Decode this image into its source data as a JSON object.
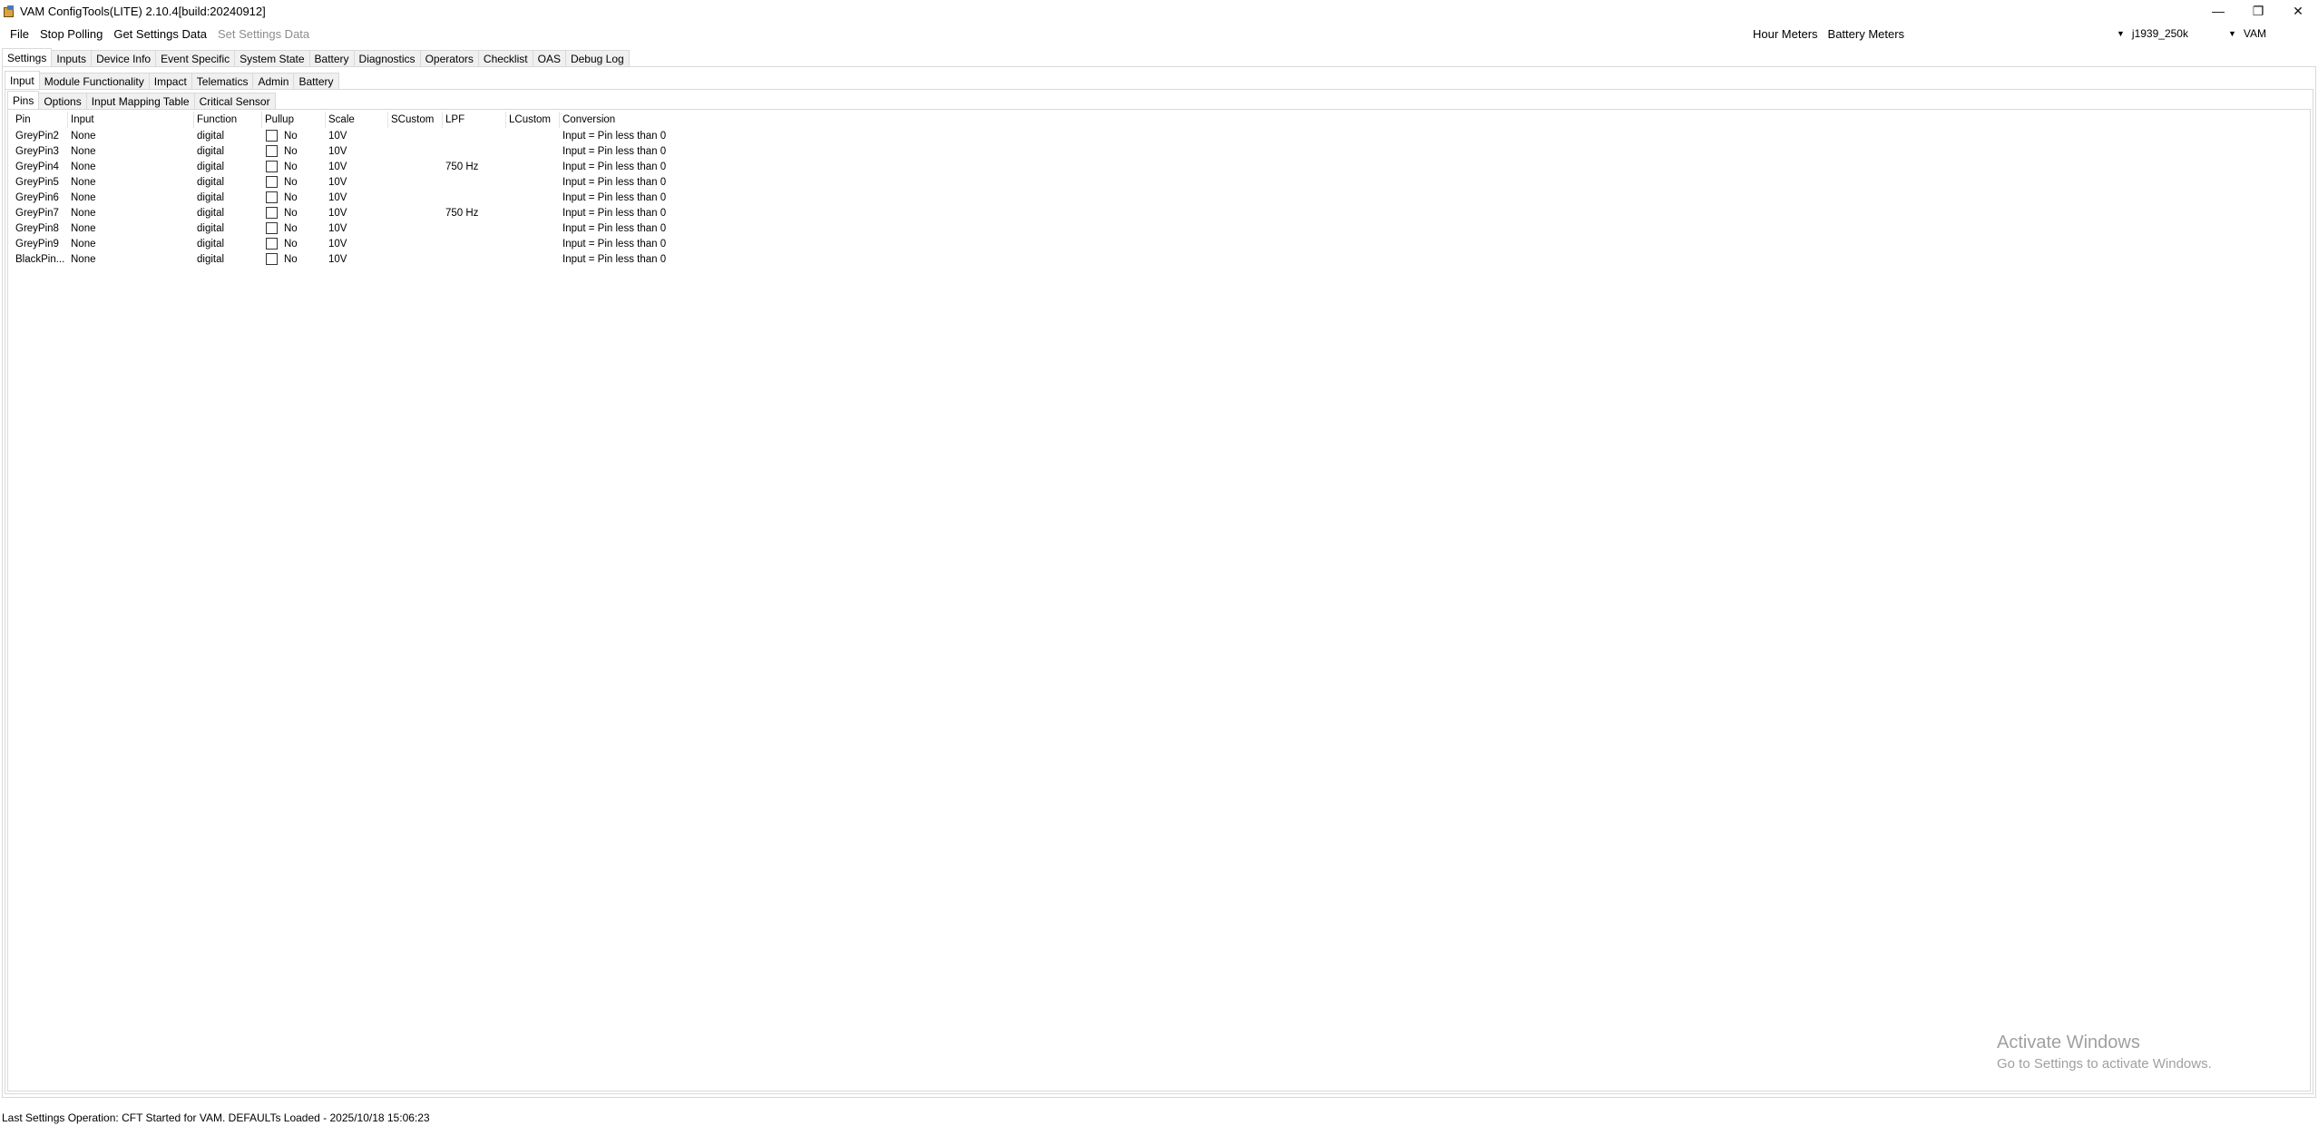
{
  "window": {
    "title": "VAM ConfigTools(LITE) 2.10.4[build:20240912]",
    "controls": {
      "minimize": "—",
      "restore": "❐",
      "close": "✕"
    }
  },
  "menu": {
    "items": [
      {
        "label": "File",
        "enabled": true
      },
      {
        "label": "Stop Polling",
        "enabled": true
      },
      {
        "label": "Get Settings Data",
        "enabled": true
      },
      {
        "label": "Set Settings Data",
        "enabled": false
      }
    ],
    "right_items": [
      "Hour Meters",
      "Battery Meters"
    ],
    "combo_baud": "j1939_250k",
    "combo_device": "VAM"
  },
  "main_tabs": [
    "Settings",
    "Inputs",
    "Device Info",
    "Event Specific",
    "System State",
    "Battery",
    "Diagnostics",
    "Operators",
    "Checklist",
    "OAS",
    "Debug Log"
  ],
  "settings_tabs": [
    "Input",
    "Module Functionality",
    "Impact",
    "Telematics",
    "Admin",
    "Battery"
  ],
  "input_tabs": [
    "Pins",
    "Options",
    "Input Mapping Table",
    "Critical Sensor"
  ],
  "table": {
    "headers": {
      "pin": "Pin",
      "input": "Input",
      "function": "Function",
      "pullup": "Pullup",
      "scale": "Scale",
      "scustom": "SCustom",
      "lpf": "LPF",
      "lcustom": "LCustom",
      "conversion": "Conversion"
    },
    "rows": [
      {
        "pin": "GreyPin2",
        "input": "None",
        "function": "digital",
        "pullup": "No",
        "scale": "10V",
        "scustom": "",
        "lpf": "",
        "lcustom": "",
        "conversion": "Input = Pin less than 0"
      },
      {
        "pin": "GreyPin3",
        "input": "None",
        "function": "digital",
        "pullup": "No",
        "scale": "10V",
        "scustom": "",
        "lpf": "",
        "lcustom": "",
        "conversion": "Input = Pin less than 0"
      },
      {
        "pin": "GreyPin4",
        "input": "None",
        "function": "digital",
        "pullup": "No",
        "scale": "10V",
        "scustom": "",
        "lpf": "750 Hz",
        "lcustom": "",
        "conversion": "Input = Pin less than 0"
      },
      {
        "pin": "GreyPin5",
        "input": "None",
        "function": "digital",
        "pullup": "No",
        "scale": "10V",
        "scustom": "",
        "lpf": "",
        "lcustom": "",
        "conversion": "Input = Pin less than 0"
      },
      {
        "pin": "GreyPin6",
        "input": "None",
        "function": "digital",
        "pullup": "No",
        "scale": "10V",
        "scustom": "",
        "lpf": "",
        "lcustom": "",
        "conversion": "Input = Pin less than 0"
      },
      {
        "pin": "GreyPin7",
        "input": "None",
        "function": "digital",
        "pullup": "No",
        "scale": "10V",
        "scustom": "",
        "lpf": "750 Hz",
        "lcustom": "",
        "conversion": "Input = Pin less than 0"
      },
      {
        "pin": "GreyPin8",
        "input": "None",
        "function": "digital",
        "pullup": "No",
        "scale": "10V",
        "scustom": "",
        "lpf": "",
        "lcustom": "",
        "conversion": "Input = Pin less than 0"
      },
      {
        "pin": "GreyPin9",
        "input": "None",
        "function": "digital",
        "pullup": "No",
        "scale": "10V",
        "scustom": "",
        "lpf": "",
        "lcustom": "",
        "conversion": "Input = Pin less than 0"
      },
      {
        "pin": "BlackPin...",
        "input": "None",
        "function": "digital",
        "pullup": "No",
        "scale": "10V",
        "scustom": "",
        "lpf": "",
        "lcustom": "",
        "conversion": "Input = Pin less than 0"
      }
    ]
  },
  "watermark": {
    "line1": "Activate Windows",
    "line2": "Go to Settings to activate Windows."
  },
  "status": "Last Settings Operation: CFT Started for VAM. DEFAULTs Loaded - 2025/10/18 15:06:23"
}
